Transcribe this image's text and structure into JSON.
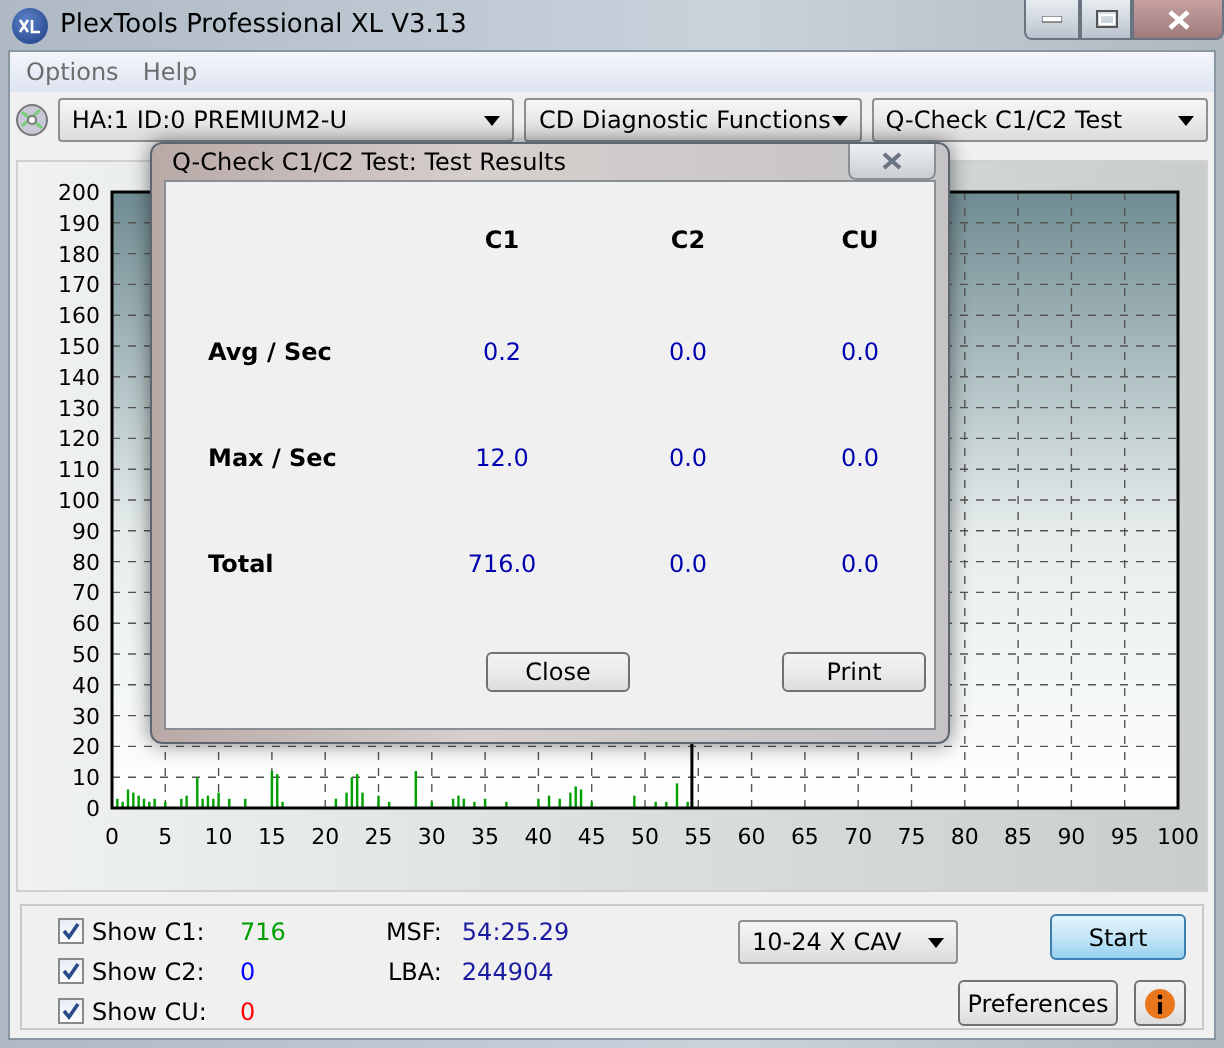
{
  "window": {
    "title": "PlexTools Professional XL V3.13"
  },
  "menu": [
    "Options",
    "Help"
  ],
  "toolbar": {
    "drive": "HA:1 ID:0  PREMIUM2-U",
    "category": "CD Diagnostic Functions",
    "test": "Q-Check C1/C2 Test"
  },
  "chart": {
    "chart_data": {
      "type": "bar",
      "x": [
        0.5,
        1,
        1.5,
        2,
        2.5,
        3,
        3.5,
        4,
        5,
        6.5,
        7,
        8,
        8.5,
        9,
        9.5,
        10,
        11,
        12.5,
        15,
        15.5,
        16,
        21,
        22,
        22.5,
        23,
        23.5,
        25,
        26,
        28.5,
        30,
        32,
        32.5,
        33,
        34,
        35,
        37,
        40,
        41,
        42,
        43,
        43.5,
        44,
        45,
        49,
        51,
        52,
        53,
        54
      ],
      "series": [
        {
          "color": "#00a000",
          "values": [
            3,
            2,
            6,
            5,
            4,
            3,
            2,
            3,
            2,
            3,
            4,
            10,
            3,
            4,
            3,
            5,
            3,
            3,
            12,
            11,
            2,
            3,
            5,
            10,
            11,
            5,
            4,
            2,
            12,
            2,
            3,
            4,
            3,
            2,
            3,
            2,
            3,
            4,
            3,
            5,
            7,
            6,
            2,
            4,
            2,
            2,
            8,
            2
          ]
        }
      ],
      "xlim": [
        0,
        100
      ],
      "ylim": [
        0,
        200
      ],
      "xticks": [
        0,
        5,
        10,
        15,
        20,
        25,
        30,
        35,
        40,
        45,
        50,
        55,
        60,
        65,
        70,
        75,
        80,
        85,
        90,
        95,
        100
      ],
      "yticks": [
        0,
        10,
        20,
        30,
        40,
        50,
        60,
        70,
        80,
        90,
        100,
        110,
        120,
        130,
        140,
        150,
        160,
        170,
        180,
        190,
        200
      ],
      "grid": true,
      "ref_lines": [
        {
          "axis": "x",
          "value": 54.4
        }
      ]
    }
  },
  "dialog": {
    "title": "Q-Check C1/C2 Test: Test Results",
    "columns": [
      "C1",
      "C2",
      "CU"
    ],
    "rows": [
      {
        "label": "Avg / Sec",
        "values": [
          "0.2",
          "0.0",
          "0.0"
        ]
      },
      {
        "label": "Max / Sec",
        "values": [
          "12.0",
          "0.0",
          "0.0"
        ]
      },
      {
        "label": "Total",
        "values": [
          "716.0",
          "0.0",
          "0.0"
        ]
      }
    ],
    "buttons": [
      "Close",
      "Print"
    ]
  },
  "show": [
    {
      "label": "Show C1:",
      "checked": true,
      "value": "716",
      "color": "#00a000"
    },
    {
      "label": "Show C2:",
      "checked": true,
      "value": "0",
      "color": "#0000ff"
    },
    {
      "label": "Show CU:",
      "checked": true,
      "value": "0",
      "color": "#ff0000"
    }
  ],
  "position": [
    {
      "label": "MSF:",
      "value": "54:25.29"
    },
    {
      "label": "LBA:",
      "value": "244904"
    }
  ],
  "speed": "10-24 X CAV",
  "buttons": {
    "start": "Start",
    "preferences": "Preferences"
  }
}
